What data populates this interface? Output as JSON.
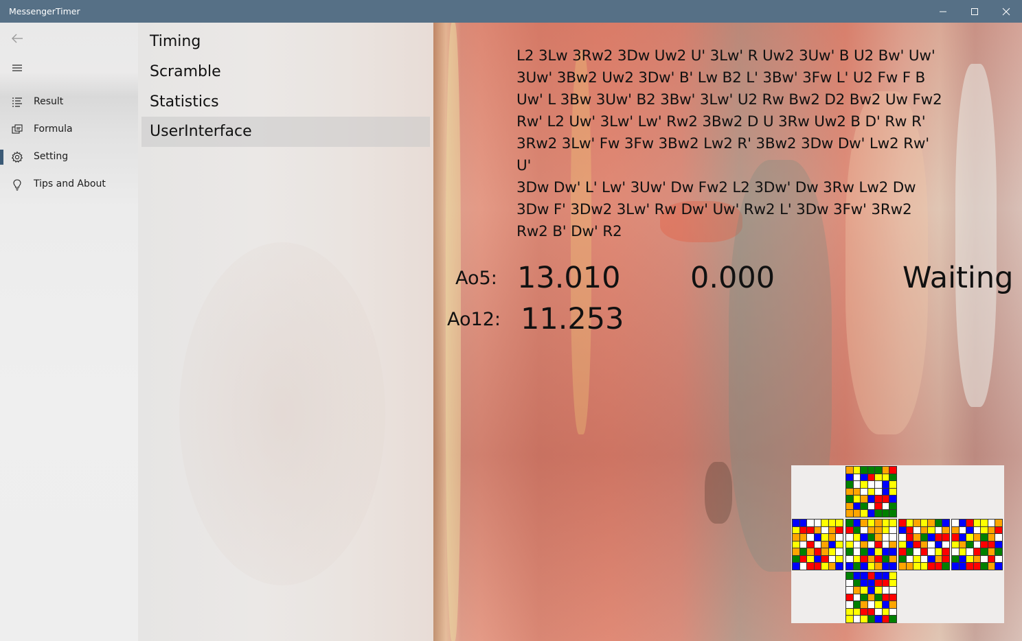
{
  "window": {
    "title": "MessengerTimer",
    "controls": [
      "minimize",
      "maximize",
      "close"
    ]
  },
  "nav": {
    "back_icon": "back-arrow-icon",
    "menu_icon": "hamburger-icon",
    "items": [
      {
        "label": "Result",
        "icon": "list-icon",
        "selected": false
      },
      {
        "label": "Formula",
        "icon": "formula-icon",
        "selected": false
      },
      {
        "label": "Setting",
        "icon": "gear-icon",
        "selected": true
      },
      {
        "label": "Tips and About",
        "icon": "lightbulb-icon",
        "selected": false
      }
    ],
    "accent": "#3b5a76"
  },
  "settings": {
    "sections": [
      {
        "label": "Timing",
        "selected": false
      },
      {
        "label": "Scramble",
        "selected": false
      },
      {
        "label": "Statistics",
        "selected": false
      },
      {
        "label": "UserInterface",
        "selected": true
      }
    ]
  },
  "timer": {
    "scramble_lines": [
      "L2 3Lw 3Rw2 3Dw Uw2 U' 3Lw' R Uw2 3Uw' B U2 Bw' Uw'",
      "3Uw' 3Bw2 Uw2 3Dw' B' Lw B2 L' 3Bw' 3Fw L' U2 Fw F B",
      "Uw' L 3Bw 3Uw' B2 3Bw' 3Lw' U2 Rw Bw2 D2 Bw2 Uw Fw2",
      "Rw' L2 Uw' 3Lw' Lw' Rw2 3Bw2 D U 3Rw Uw2 B D' Rw R'",
      "3Rw2 3Lw' Fw 3Fw 3Bw2 Lw2 R' 3Bw2 3Dw Dw' Lw2 Rw' U'",
      "3Dw Dw' L' Lw' 3Uw' Dw Fw2 L2 3Dw' Dw 3Rw Lw2 Dw",
      "3Dw F' 3Dw2 3Lw' Rw Dw' Uw' Rw2 L' 3Dw 3Fw' 3Rw2",
      "Rw2 B' Dw' R2"
    ],
    "ao5_label": "Ao5:",
    "ao5_value": "13.010",
    "ao12_label": "Ao12:",
    "ao12_value": "11.253",
    "time": "0.000",
    "state": "Waiting"
  },
  "cube_colors": {
    "W": "#ffffff",
    "Y": "#ffff00",
    "R": "#ff0000",
    "O": "#ffa500",
    "B": "#0000ff",
    "G": "#008000"
  },
  "cube_faces": [
    {
      "name": "U",
      "rows": [
        "OYGGGOR",
        "BWBRYYG",
        "GWYWWBY",
        "OOWYWBY",
        "GYOBRRB",
        "OBGWRWG",
        "OOYBGGG"
      ]
    },
    {
      "name": "L",
      "rows": [
        "BBWWYYY",
        "YRROWOR",
        "OOWBYOW",
        "YWRWOBY",
        "OGOROYW",
        "GRYBRWY",
        "BWRRYOB"
      ]
    },
    {
      "name": "F",
      "rows": [
        "GBOYOYY",
        "RGWOOYW",
        "WYBGOWW",
        "YWOWRWO",
        "GWGBYBB",
        "WYRORGO",
        "BGBYOBB"
      ]
    },
    {
      "name": "R",
      "rows": [
        "RYOYOGB",
        "BRWOYWO",
        "WROGBRR",
        "YBROWBW",
        "RGWRWYR",
        "GWYWBOR",
        "OOYYRRG"
      ]
    },
    {
      "name": "B",
      "rows": [
        "WBRYYWO",
        "OWBWYOR",
        "RBYOGOW",
        "YOGWRRB",
        "WYWRGOG",
        "GBYOWRW",
        "BBRRGOB"
      ]
    },
    {
      "name": "D",
      "rows": [
        "GBBRBBY",
        "WGBBRRY",
        "WOYBYWW",
        "RWGOGRR",
        "WGOWYBO",
        "YYRRWYW",
        "YWYGBRG"
      ]
    }
  ]
}
